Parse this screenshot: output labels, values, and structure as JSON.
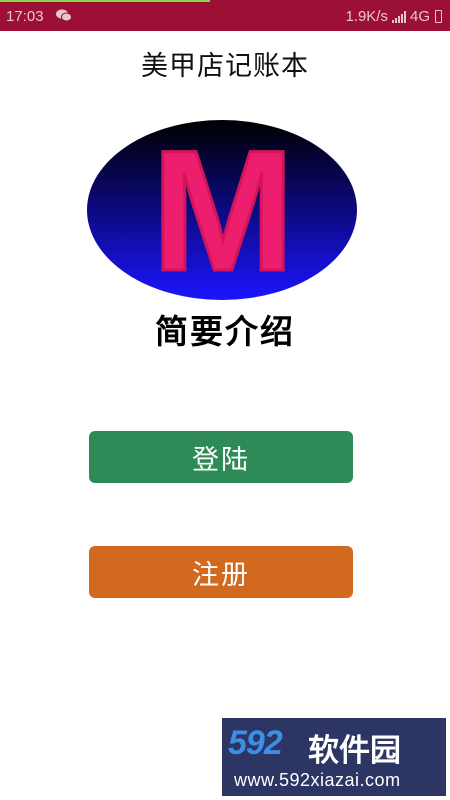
{
  "status_bar": {
    "time": "17:03",
    "network_speed": "1.9K/s",
    "network_type": "4G",
    "app_notification_icon": "wechat-icon",
    "bg_color": "#9b1034"
  },
  "header": {
    "title": "美甲店记账本"
  },
  "logo": {
    "letter": "M",
    "letter_color": "#ee1e6e"
  },
  "intro": {
    "heading": "简要介绍"
  },
  "actions": {
    "login_label": "登陆",
    "login_color": "#2e8b57",
    "register_label": "注册",
    "register_color": "#d2691e"
  },
  "watermark": {
    "brand_number": "592",
    "brand_text": "软件园",
    "url": "www.592xiazai.com"
  }
}
